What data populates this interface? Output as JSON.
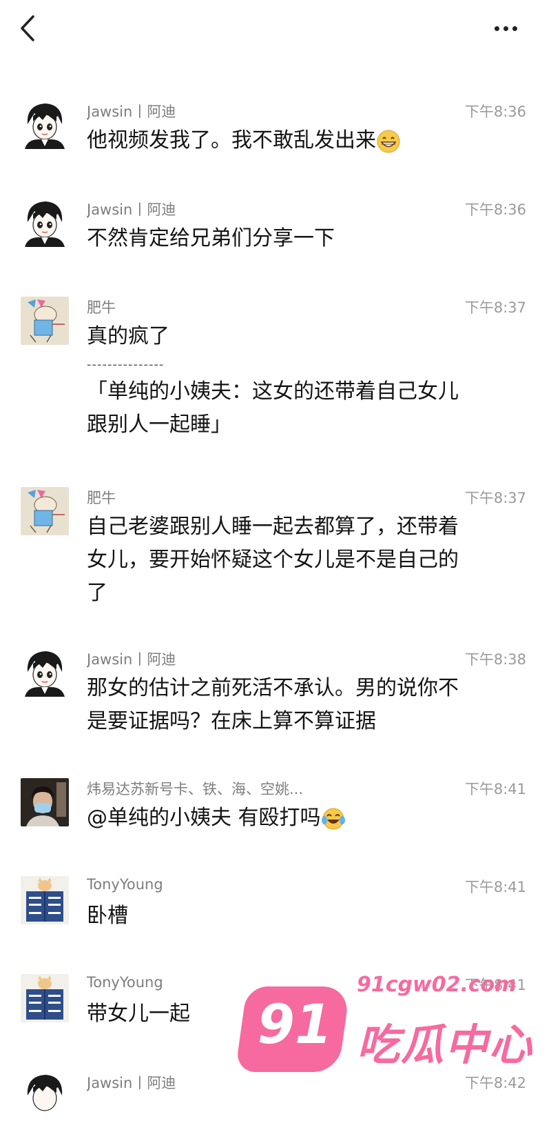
{
  "header": {
    "back_icon": "chevron-left-icon",
    "more_icon": "more-horizontal-icon"
  },
  "messages": [
    {
      "sender": "Jawsin丨阿迪",
      "time": "下午8:36",
      "lines": [
        "他视频发我了。我不敢乱发出来"
      ],
      "emoji": "grinning-face"
    },
    {
      "sender": "Jawsin丨阿迪",
      "time": "下午8:36",
      "lines": [
        "不然肯定给兄弟们分享一下"
      ]
    },
    {
      "sender": "肥牛",
      "time": "下午8:37",
      "lines": [
        "真的疯了"
      ],
      "separator": "---------------",
      "quote": [
        "「单纯的小姨夫：这女的还带着自己女儿",
        "跟别人一起睡」"
      ]
    },
    {
      "sender": "肥牛",
      "time": "下午8:37",
      "lines": [
        "自己老婆跟别人睡一起去都算了，还带着",
        "女儿，要开始怀疑这个女儿是不是自己的",
        "了"
      ]
    },
    {
      "sender": "Jawsin丨阿迪",
      "time": "下午8:38",
      "lines": [
        "那女的估计之前死活不承认。男的说你不",
        "是要证据吗？在床上算不算证据"
      ]
    },
    {
      "sender": "炜易达苏新号卡、铁、海、空姚...",
      "time": "下午8:41",
      "lines": [
        "@单纯的小姨夫 有殴打吗"
      ],
      "emoji": "tears-of-joy"
    },
    {
      "sender": "TonyYoung",
      "time": "下午8:41",
      "lines": [
        "卧槽"
      ]
    },
    {
      "sender": "TonyYoung",
      "time": "下午8:41",
      "lines": [
        "带女儿一起"
      ]
    },
    {
      "sender": "Jawsin丨阿迪",
      "time": "下午8:42",
      "lines": []
    }
  ],
  "watermark": {
    "badge": "91",
    "url": "91cgw02.com",
    "name": "吃瓜中心",
    "color": "#f66aa0"
  }
}
